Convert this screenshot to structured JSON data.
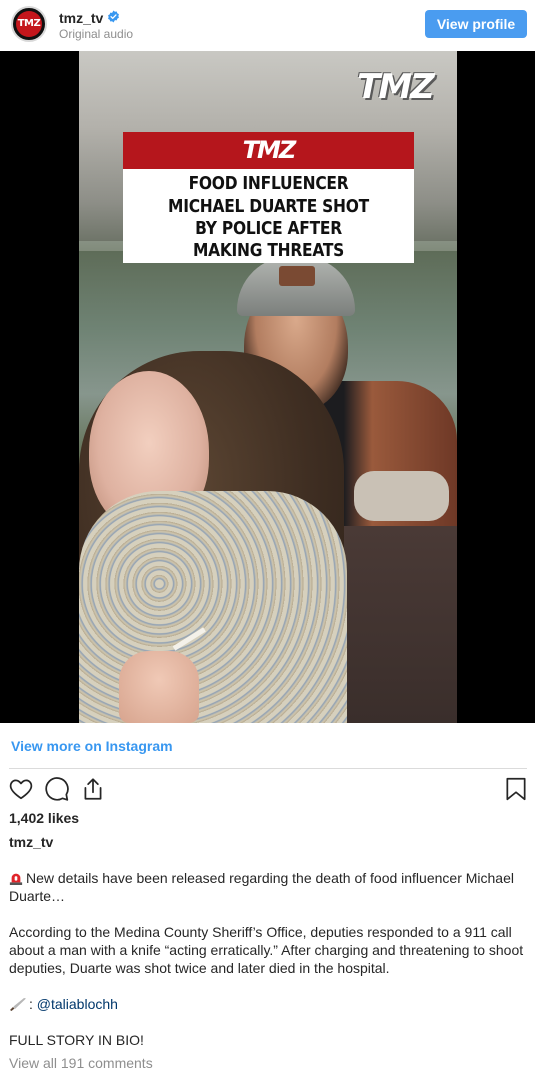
{
  "header": {
    "avatar_label": "TMZ",
    "username": "tmz_tv",
    "verified_icon": "verified-badge-icon",
    "subtitle": "Original audio",
    "view_profile_label": "View profile"
  },
  "media": {
    "watermark": "TMZ",
    "card": {
      "logo": "TMZ",
      "headline_lines": [
        "FOOD INFLUENCER",
        "MICHAEL DUARTE SHOT",
        "BY POLICE AFTER",
        "MAKING THREATS"
      ]
    }
  },
  "view_more": "View more on Instagram",
  "actions": {
    "like_icon": "heart-icon",
    "comment_icon": "comment-icon",
    "share_icon": "share-icon",
    "save_icon": "bookmark-icon"
  },
  "likes": "1,402 likes",
  "caption": {
    "username": "tmz_tv",
    "line1": "New details have been released regarding the death of food influencer Michael Duarte…",
    "line2": "According to the Medina County Sheriff’s Office, deputies responded to a 911 call about a man with a knife “acting erratically.” After charging and threatening to shoot deputies, Duarte was shot twice and later died in the hospital.",
    "credit_prefix": ": ",
    "credit_mention": "@taliablochh",
    "line4": "FULL STORY IN BIO!"
  },
  "comments_link": "View all 191 comments",
  "colors": {
    "button_blue": "#4a9cf0",
    "link_blue": "#3897f0",
    "tmz_red": "#b5161c"
  }
}
